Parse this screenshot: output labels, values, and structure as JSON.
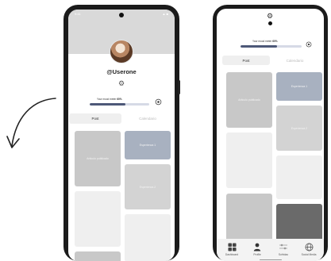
{
  "left_phone": {
    "status_time": "9:41",
    "status_icons": "▲ ■",
    "username": "@Userone",
    "mood": {
      "label": "Your mood meter",
      "percent_label": "60%",
      "fraction": 0.6
    },
    "tabs": [
      {
        "label": "Post",
        "active": true
      },
      {
        "label": "Calendario",
        "active": false
      }
    ],
    "cards": [
      {
        "label": "Articulo publicado"
      },
      {
        "label": "Esperienca 1"
      },
      {
        "label": "Esperienca 2"
      },
      {
        "label": ""
      },
      {
        "label": ""
      },
      {
        "label": ""
      }
    ]
  },
  "right_phone": {
    "mood": {
      "label": "Your mood meter",
      "percent_label": "60%",
      "fraction": 0.6
    },
    "tabs": [
      {
        "label": "Post",
        "active": true
      },
      {
        "label": "Calendario",
        "active": false
      }
    ],
    "cards": [
      {
        "label": "Articulo publicado"
      },
      {
        "label": "Esperienca 1"
      },
      {
        "label": "Esperienca 2"
      },
      {
        "label": ""
      },
      {
        "label": ""
      },
      {
        "label": ""
      },
      {
        "label": ""
      }
    ],
    "nav": [
      {
        "label": "Dashboard",
        "icon": "grid-icon"
      },
      {
        "label": "Profile",
        "icon": "person-icon"
      },
      {
        "label": "Sofridao",
        "icon": "sliders-icon"
      },
      {
        "label": "Social Media",
        "icon": "globe-icon"
      }
    ]
  },
  "colors": {
    "mood_fill": "#4d5878",
    "mood_track": "#d6dae6",
    "card_blue": "#a8b1c0",
    "card_gray": "#c8c8c8",
    "card_dark": "#6a6a6a",
    "frame": "#1b1b1b"
  }
}
